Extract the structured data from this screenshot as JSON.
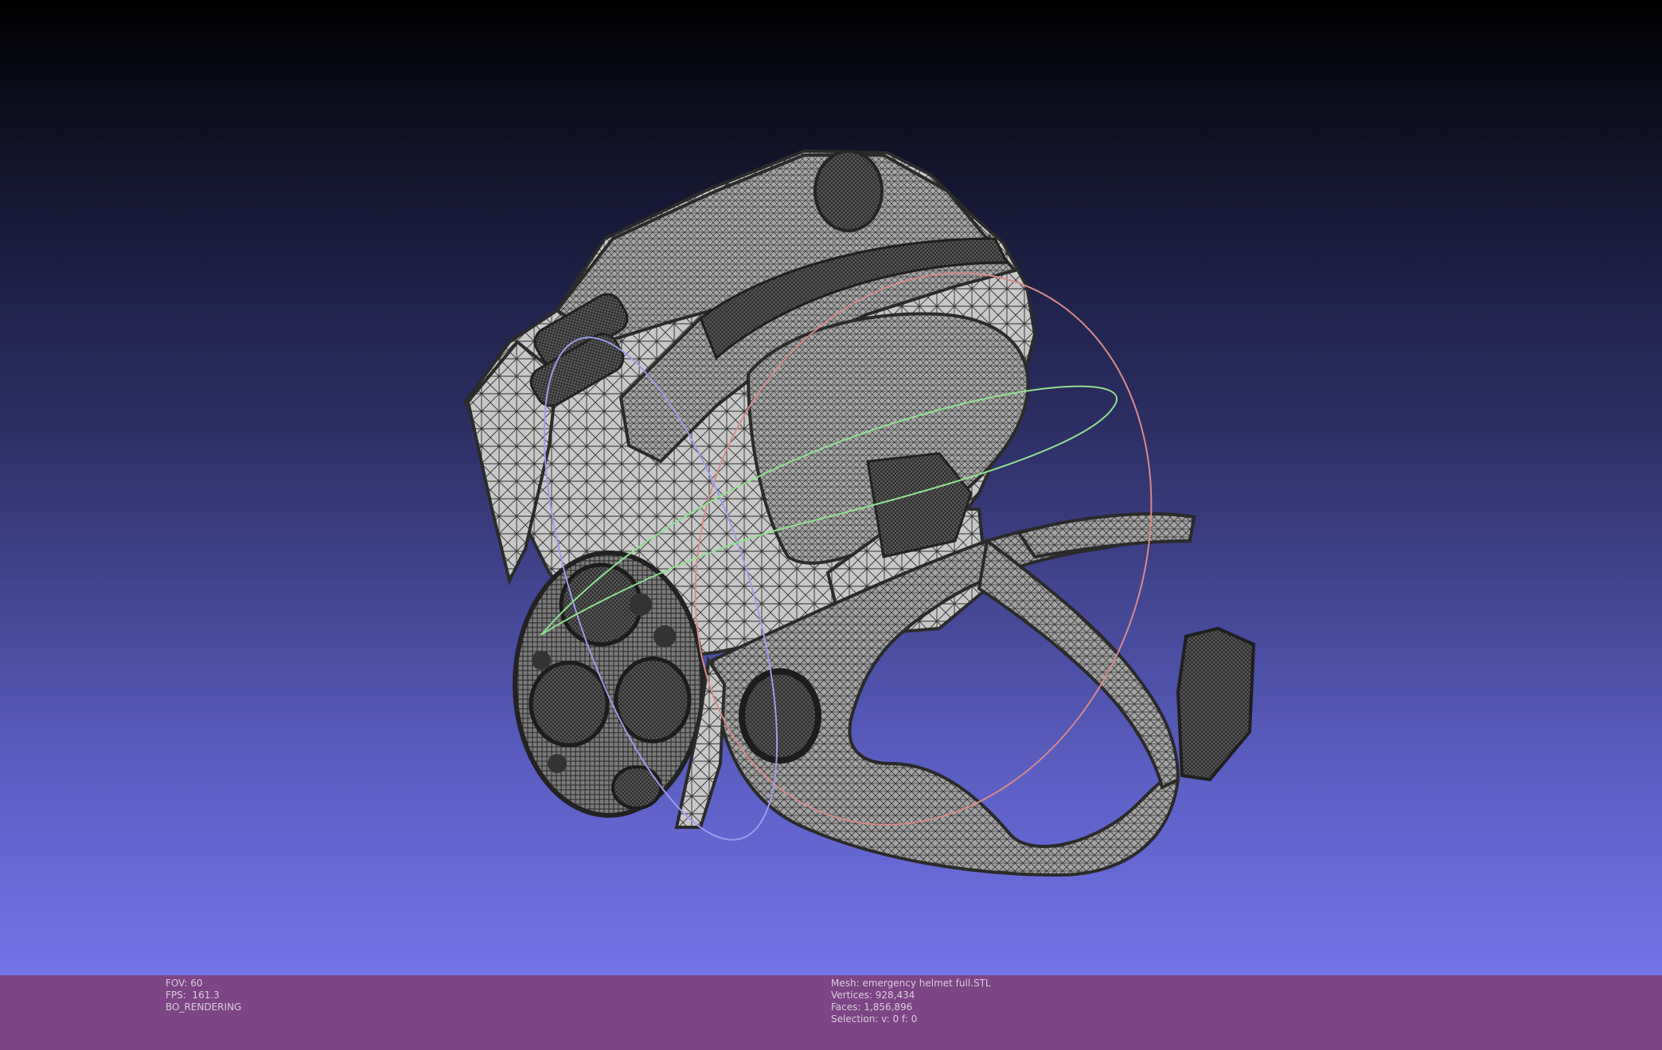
{
  "viewer": {
    "background_top": "#000000",
    "background_bottom": "#7274e8",
    "info_bar_color": "#7c4584",
    "info_text_color": "#d8cedb"
  },
  "model": {
    "object": "helmet-wireframe",
    "render_mode": "wireframe",
    "mesh_color": "#9c9c9c",
    "edge_color": "#3c3c3c"
  },
  "trackball": {
    "x_ring_color": "#d48a8a",
    "y_ring_color": "#8fe08f",
    "z_ring_color": "#9b9bea"
  },
  "status": {
    "fov": "FOV: 60",
    "fps": "FPS:  161.3",
    "mode": "BO_RENDERING",
    "mesh": "Mesh: emergency helmet full.STL",
    "vertices": "Vertices: 928,434",
    "faces": "Faces: 1,856,896",
    "selection": "Selection: v: 0 f: 0"
  }
}
